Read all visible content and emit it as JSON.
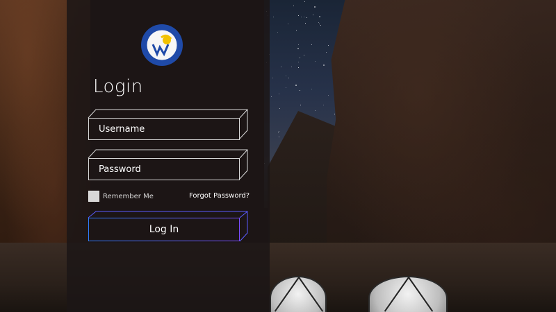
{
  "logo": {
    "icon": "university-seal-icon",
    "colors": {
      "ring": "#1f4aa8",
      "accent": "#f2c200"
    }
  },
  "form": {
    "title": "Login",
    "username_placeholder": "Username",
    "password_placeholder": "Password",
    "remember_label": "Remember Me",
    "forgot_label": "Forgot Password?",
    "submit_label": "Log In"
  },
  "colors": {
    "panel": "#1c1616",
    "field_border": "#d9d9d9",
    "button_border_start": "#2f7dff",
    "button_border_end": "#7b4dff"
  }
}
